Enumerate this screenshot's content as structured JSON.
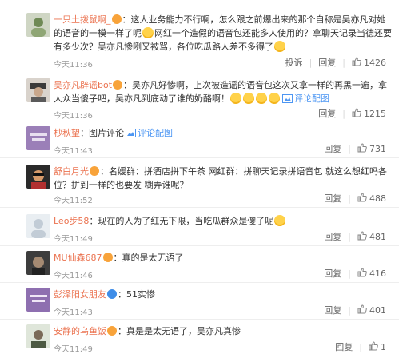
{
  "comments": [
    {
      "nick": "一只土拨鼠啊_",
      "badge": "orange",
      "segments_before": "：这人业务能力不行啊，怎么跟之前爆出来的那个自称是吴亦凡对她的语音的一模一样了呢",
      "segments_after": "网红一个造假的语音包还能多人使用的？拿聊天记录当德还要有多少次？吴亦凡惨咧又被骂，各位吃瓜路人差不多得了",
      "time": "今天11:36",
      "actions": [
        "投诉",
        "回复"
      ],
      "likes": "1426"
    },
    {
      "nick": "吴亦凡辟谣bot",
      "badge": "orange",
      "text": "：吴亦凡好惨啊，上次被造谣的语音包这次又拿一样的再黑一遍，拿大众当傻子吧，吴亦凡到底动了谁的奶酪啊！",
      "link": "评论配图",
      "time": "今天11:36",
      "actions": [
        "回复"
      ],
      "likes": "1215"
    },
    {
      "nick": "杪秋望",
      "text": "：图片评论",
      "link": "评论配图",
      "time": "今天11:43",
      "actions": [
        "回复"
      ],
      "likes": "731"
    },
    {
      "nick": "舒白月光",
      "badge": "orange",
      "text": "：名媛群：拼酒店拼下午茶 网红群：拼聊天记录拼语音包 就这么想红吗各位？拼到一样的也要发 糊弄谁呢？",
      "time": "今天11:52",
      "actions": [
        "回复"
      ],
      "likes": "488"
    },
    {
      "nick": "Leo步58",
      "text": "：现在的人为了红无下限，当吃瓜群众是傻子呢",
      "time": "今天11:49",
      "actions": [
        "回复"
      ],
      "likes": "481"
    },
    {
      "nick": "MU仙森687",
      "badge": "orange",
      "text": "：真的是太无语了",
      "time": "今天11:46",
      "actions": [
        "回复"
      ],
      "likes": "416"
    },
    {
      "nick": "彭泽阳女朋友",
      "badge": "blue",
      "text": "：51实惨",
      "time": "今天11:43",
      "actions": [
        "回复"
      ],
      "likes": "401"
    },
    {
      "nick": "安静的乌鱼饭",
      "badge": "orange",
      "text": "：真是是太无语了，吴亦凡真惨",
      "time": "今天11:49",
      "actions": [
        "回复"
      ],
      "likes": "1"
    }
  ]
}
